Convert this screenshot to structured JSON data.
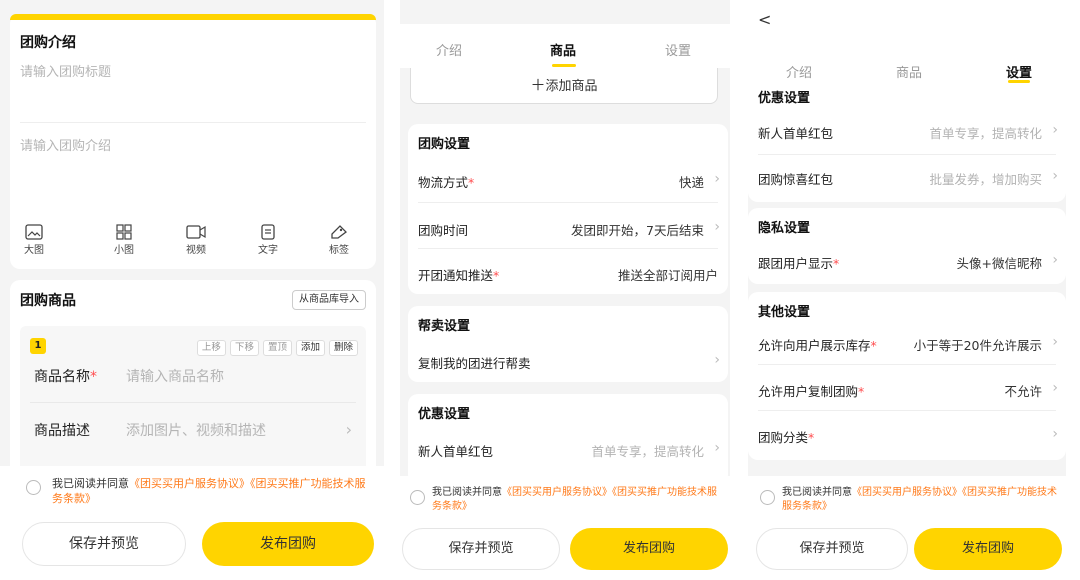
{
  "colors": {
    "accent": "#ffd400",
    "link": "#ff7a1a",
    "required": "#ff4d4f"
  },
  "panel1": {
    "intro_title": "团购介绍",
    "title_placeholder": "请输入团购标题",
    "intro_placeholder": "请输入团购介绍",
    "tools": [
      {
        "label": "大图",
        "icon": "large-image-icon"
      },
      {
        "label": "小图",
        "icon": "small-image-grid-icon"
      },
      {
        "label": "视频",
        "icon": "video-icon"
      },
      {
        "label": "文字",
        "icon": "text-doc-icon"
      },
      {
        "label": "标签",
        "icon": "tag-icon"
      }
    ],
    "goods_title": "团购商品",
    "import_button": "从商品库导入",
    "item_index": "1",
    "item_actions": [
      "上移",
      "下移",
      "置顶",
      "添加",
      "删除"
    ],
    "name_label": "商品名称",
    "name_required": "*",
    "name_placeholder": "请输入商品名称",
    "desc_label": "商品描述",
    "desc_placeholder": "添加图片、视频和描述"
  },
  "panel2": {
    "tabs": [
      "介绍",
      "商品",
      "设置"
    ],
    "add_goods": "添加商品",
    "group_settings_title": "团购设置",
    "group_settings": [
      {
        "label": "物流方式",
        "required": "*",
        "value": "快递"
      },
      {
        "label": "团购时间",
        "required": "",
        "value": "发团即开始，7天后结束"
      },
      {
        "label": "开团通知推送",
        "required": "*",
        "value": "推送全部订阅用户"
      }
    ],
    "help_title": "帮卖设置",
    "help_row": "复制我的团进行帮卖",
    "discount_title": "优惠设置",
    "discount_row": {
      "label": "新人首单红包",
      "value": "首单专享，提高转化"
    }
  },
  "panel3": {
    "back": "<",
    "tabs": [
      "介绍",
      "商品",
      "设置"
    ],
    "discount_title": "优惠设置",
    "discount": [
      {
        "label": "新人首单红包",
        "value": "首单专享，提高转化"
      },
      {
        "label": "团购惊喜红包",
        "value": "批量发券，增加购买"
      }
    ],
    "privacy_title": "隐私设置",
    "privacy": {
      "label": "跟团用户显示",
      "required": "*",
      "value": "头像+微信昵称"
    },
    "other_title": "其他设置",
    "other": [
      {
        "label": "允许向用户展示库存",
        "required": "*",
        "value": "小于等于20件允许展示"
      },
      {
        "label": "允许用户复制团购",
        "required": "*",
        "value": "不允许"
      },
      {
        "label": "团购分类",
        "required": "*",
        "value": ""
      }
    ]
  },
  "footer": {
    "agree_prefix": "我已阅读并同意",
    "agree_link1": "《团买买用户服务协议》",
    "agree_link2": "《团买买推广功能技术服务条款》",
    "save_button": "保存并预览",
    "publish_button": "发布团购"
  }
}
